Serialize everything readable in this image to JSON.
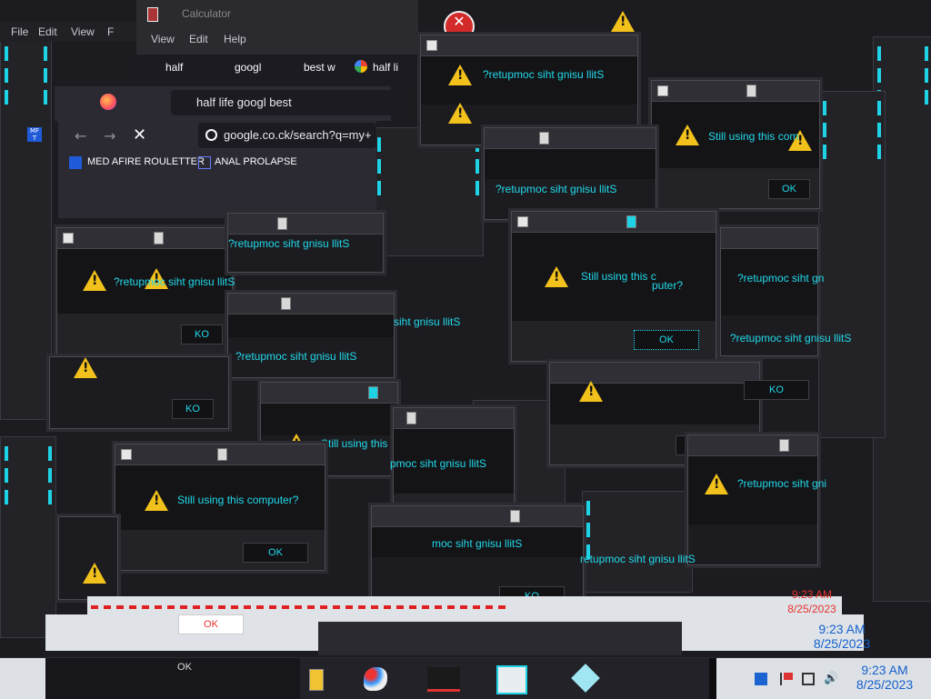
{
  "calculator": {
    "title": "Calculator",
    "menu": [
      "View",
      "Edit",
      "Help"
    ]
  },
  "notepad_menu": [
    "File",
    "Edit",
    "View",
    "F"
  ],
  "browser": {
    "tabs": [
      "half",
      "googl",
      "best w",
      "half li"
    ],
    "search_text": "half  life  googl  best",
    "address": "google.co.ck/search?q=my+",
    "bookmarks": [
      "MED AFIRE ROULETTER",
      "ANAL PROLAPSE"
    ],
    "bookmark_icon_text": "MF T"
  },
  "dialog": {
    "message": "Still using this computer?",
    "message_mirrored": "?retupmoc siht gnisu llitS",
    "message_cut": "Still using this c",
    "message_cut2": "Still using this com",
    "message_cut3": "Still using this co",
    "message_tail": "puter?",
    "fragment1": "retupmoc siht gnisu llitS",
    "fragment2": "pmoc siht gnisu llitS",
    "fragment3": "moc siht gnisu llitS",
    "fragment4": "?retupmoc siht gni",
    "fragment5": "siht gnisu llitS",
    "fragment6": "?retupmoc siht gn",
    "fragment7": "?retupmoc siht gnisu  llitS",
    "ok": "OK",
    "ok_mirrored": "KO",
    "ok_fragment": "K",
    "ok_fragment2": "O"
  },
  "taskbar": {
    "clock_time": "9:23 AM",
    "clock_date": "8/25/2023",
    "accent": "#1fd3e6",
    "warning_color": "#f2c11b",
    "icons": [
      "file-explorer-icon",
      "paint-icon",
      "media-player-icon",
      "notepad-icon",
      "cube-icon"
    ]
  }
}
